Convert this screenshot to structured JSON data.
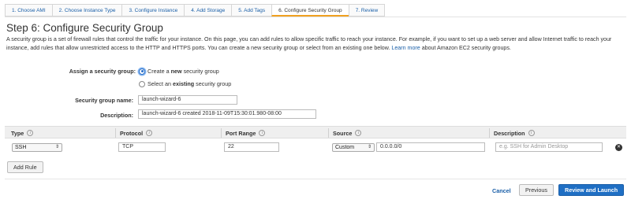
{
  "tabs": [
    {
      "label": "1. Choose AMI"
    },
    {
      "label": "2. Choose Instance Type"
    },
    {
      "label": "3. Configure Instance"
    },
    {
      "label": "4. Add Storage"
    },
    {
      "label": "5. Add Tags"
    },
    {
      "label": "6. Configure Security Group"
    },
    {
      "label": "7. Review"
    }
  ],
  "page": {
    "title": "Step 6: Configure Security Group",
    "intro": "A security group is a set of firewall rules that control the traffic for your instance. On this page, you can add rules to allow specific traffic to reach your instance. For example, if you want to set up a web server and allow Internet traffic to reach your instance, add rules that allow unrestricted access to the HTTP and HTTPS ports. You can create a new security group or select from an existing one below.",
    "learn_more": "Learn more",
    "intro_tail": "about Amazon EC2 security groups."
  },
  "assign": {
    "label": "Assign a security group:",
    "option_create_pre": "Create a",
    "option_create_bold": "new",
    "option_create_post": "security group",
    "option_select_pre": "Select an",
    "option_select_bold": "existing",
    "option_select_post": "security group",
    "selected": "create"
  },
  "group_name": {
    "label": "Security group name:",
    "value": "launch-wizard-6"
  },
  "description": {
    "label": "Description:",
    "value": "launch-wizard-6 created 2018-11-09T15:30:01.980-08:00"
  },
  "table": {
    "headers": {
      "type": "Type",
      "protocol": "Protocol",
      "port_range": "Port Range",
      "source": "Source",
      "description": "Description"
    },
    "info_glyph": "i",
    "rows": [
      {
        "type": "SSH",
        "protocol": "TCP",
        "port_range": "22",
        "source_mode": "Custom",
        "source_cidr": "0.0.0.0/0",
        "description_placeholder": "e.g. SSH for Admin Desktop"
      }
    ]
  },
  "buttons": {
    "add_rule": "Add Rule",
    "cancel": "Cancel",
    "previous": "Previous",
    "review_launch": "Review and Launch"
  },
  "colors": {
    "accent": "#1f6fc4",
    "tab_active_underline": "#f0a020",
    "link": "#1a5fa8"
  }
}
